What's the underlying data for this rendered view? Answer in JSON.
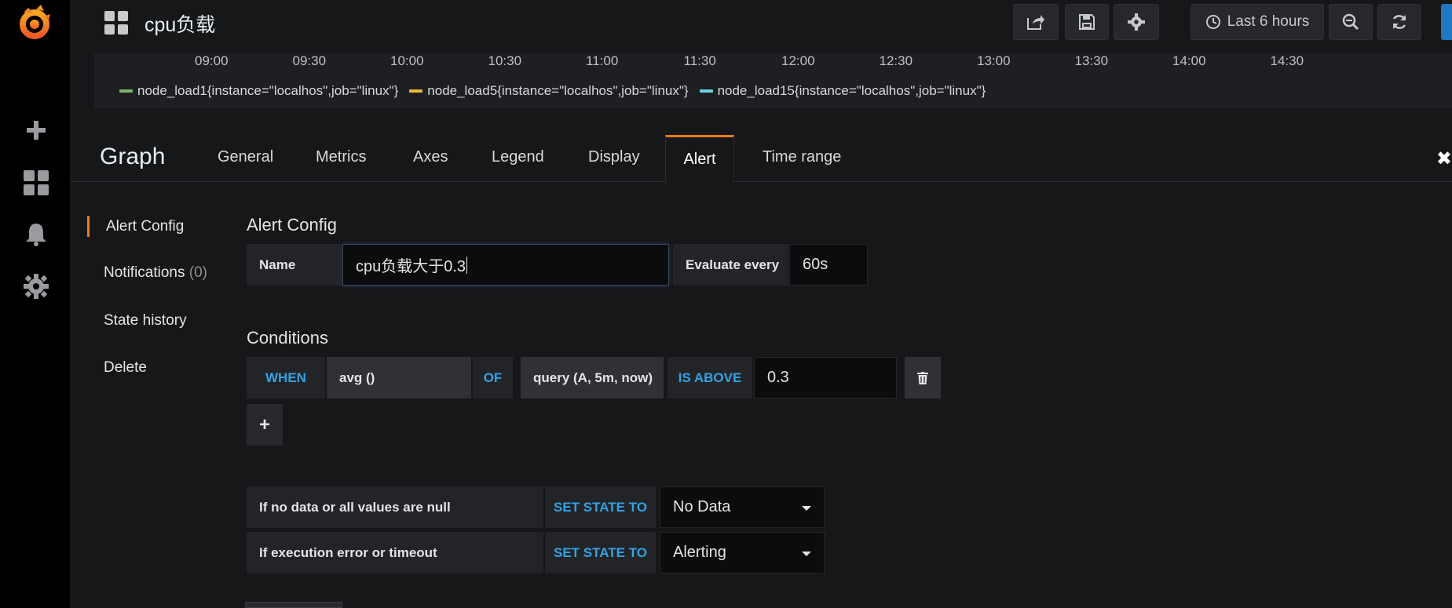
{
  "topbar": {
    "title": "cpu负载",
    "time_range_label": "Last 6 hours"
  },
  "time_axis": {
    "ticks": [
      "09:00",
      "09:30",
      "10:00",
      "10:30",
      "11:00",
      "11:30",
      "12:00",
      "12:30",
      "13:00",
      "13:30",
      "14:00",
      "14:30"
    ]
  },
  "legend": {
    "items": [
      {
        "label": "node_load1{instance=\"localhos\",job=\"linux\"}",
        "color": "#7eb26d"
      },
      {
        "label": "node_load5{instance=\"localhos\",job=\"linux\"}",
        "color": "#eab839"
      },
      {
        "label": "node_load15{instance=\"localhos\",job=\"linux\"}",
        "color": "#6ed0e0"
      }
    ]
  },
  "editor": {
    "panel_type": "Graph",
    "tabs": [
      "General",
      "Metrics",
      "Axes",
      "Legend",
      "Display",
      "Alert",
      "Time range"
    ],
    "active_tab": "Alert",
    "close_glyph": "✖"
  },
  "subnav": {
    "alert_config": "Alert Config",
    "notifications": "Notifications",
    "notifications_count": "(0)",
    "state_history": "State history",
    "delete": "Delete"
  },
  "alert_config": {
    "heading": "Alert Config",
    "name_label": "Name",
    "name_value": "cpu负载大于0.3",
    "evaluate_label": "Evaluate every",
    "evaluate_value": "60s"
  },
  "conditions": {
    "heading": "Conditions",
    "when": "WHEN",
    "reducer": "avg ()",
    "of": "OF",
    "query": "query (A, 5m, now)",
    "evaluator": "IS ABOVE",
    "threshold": "0.3",
    "add_glyph": "+"
  },
  "no_data": {
    "label": "If no data or all values are null",
    "set_state": "SET STATE TO",
    "value": "No Data"
  },
  "exec_error": {
    "label": "If execution error or timeout",
    "set_state": "SET STATE TO",
    "value": "Alerting"
  },
  "colors": {
    "accent": "#eb7b18",
    "keyword_blue": "#33a2e5"
  }
}
